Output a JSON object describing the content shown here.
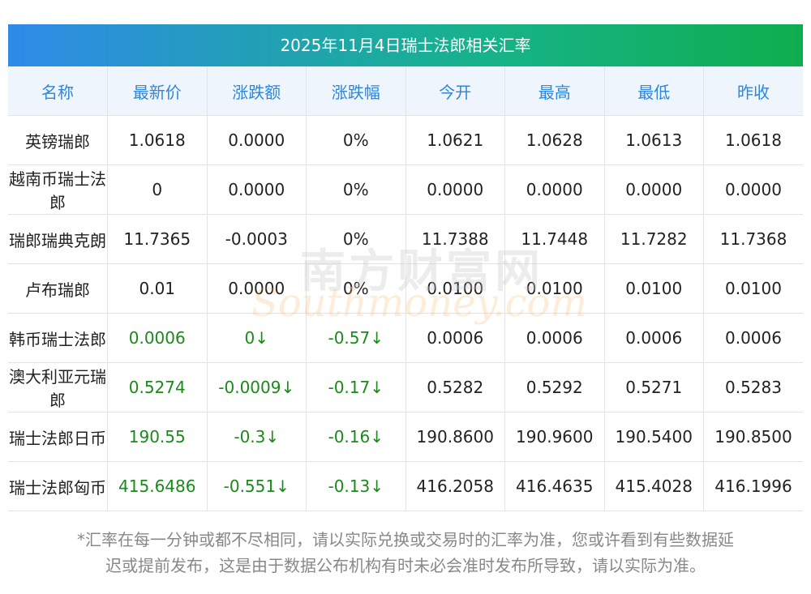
{
  "title": "2025年11月4日瑞士法郎相关汇率",
  "columns": [
    "名称",
    "最新价",
    "涨跌额",
    "涨跌幅",
    "今开",
    "最高",
    "最低",
    "昨收"
  ],
  "rows": [
    {
      "name": "英镑瑞郎",
      "latest": "1.0618",
      "change": "0.0000",
      "pct": "0%",
      "open": "1.0621",
      "high": "1.0628",
      "low": "1.0613",
      "prev": "1.0618",
      "highlight": false
    },
    {
      "name": "越南币瑞士法郎",
      "latest": "0",
      "change": "0.0000",
      "pct": "0%",
      "open": "0.0000",
      "high": "0.0000",
      "low": "0.0000",
      "prev": "0.0000",
      "highlight": false
    },
    {
      "name": "瑞郎瑞典克朗",
      "latest": "11.7365",
      "change": "-0.0003",
      "pct": "0%",
      "open": "11.7388",
      "high": "11.7448",
      "low": "11.7282",
      "prev": "11.7368",
      "highlight": false
    },
    {
      "name": "卢布瑞郎",
      "latest": "0.01",
      "change": "0.0000",
      "pct": "0%",
      "open": "0.0100",
      "high": "0.0100",
      "low": "0.0100",
      "prev": "0.0100",
      "highlight": false
    },
    {
      "name": "韩币瑞士法郎",
      "latest": "0.0006",
      "change": "0↓",
      "pct": "-0.57↓",
      "open": "0.0006",
      "high": "0.0006",
      "low": "0.0006",
      "prev": "0.0006",
      "highlight": true
    },
    {
      "name": "澳大利亚元瑞郎",
      "latest": "0.5274",
      "change": "-0.0009↓",
      "pct": "-0.17↓",
      "open": "0.5282",
      "high": "0.5292",
      "low": "0.5271",
      "prev": "0.5283",
      "highlight": true
    },
    {
      "name": "瑞士法郎日币",
      "latest": "190.55",
      "change": "-0.3↓",
      "pct": "-0.16↓",
      "open": "190.8600",
      "high": "190.9600",
      "low": "190.5400",
      "prev": "190.8500",
      "highlight": true
    },
    {
      "name": "瑞士法郎匈币",
      "latest": "415.6486",
      "change": "-0.551↓",
      "pct": "-0.13↓",
      "open": "416.2058",
      "high": "416.4635",
      "low": "415.4028",
      "prev": "416.1996",
      "highlight": true
    }
  ],
  "note_line1": "*汇率在每一分钟或都不尽相同，请以实际兑换或交易时的汇率为准，您或许看到有些数据延",
  "note_line2": "迟或提前发布，这是由于数据公布机构有时未必会准时发布所导致，请以实际为准。",
  "watermark_cn": "南方财富网",
  "watermark_en": "Southmoney.com",
  "colors": {
    "header_gradient_start": "#2f8ae8",
    "header_gradient_end": "#10ad4f",
    "column_header_text": "#2f86db",
    "column_header_bg": "#eef5fd",
    "down_change": "#1a8a1a"
  }
}
